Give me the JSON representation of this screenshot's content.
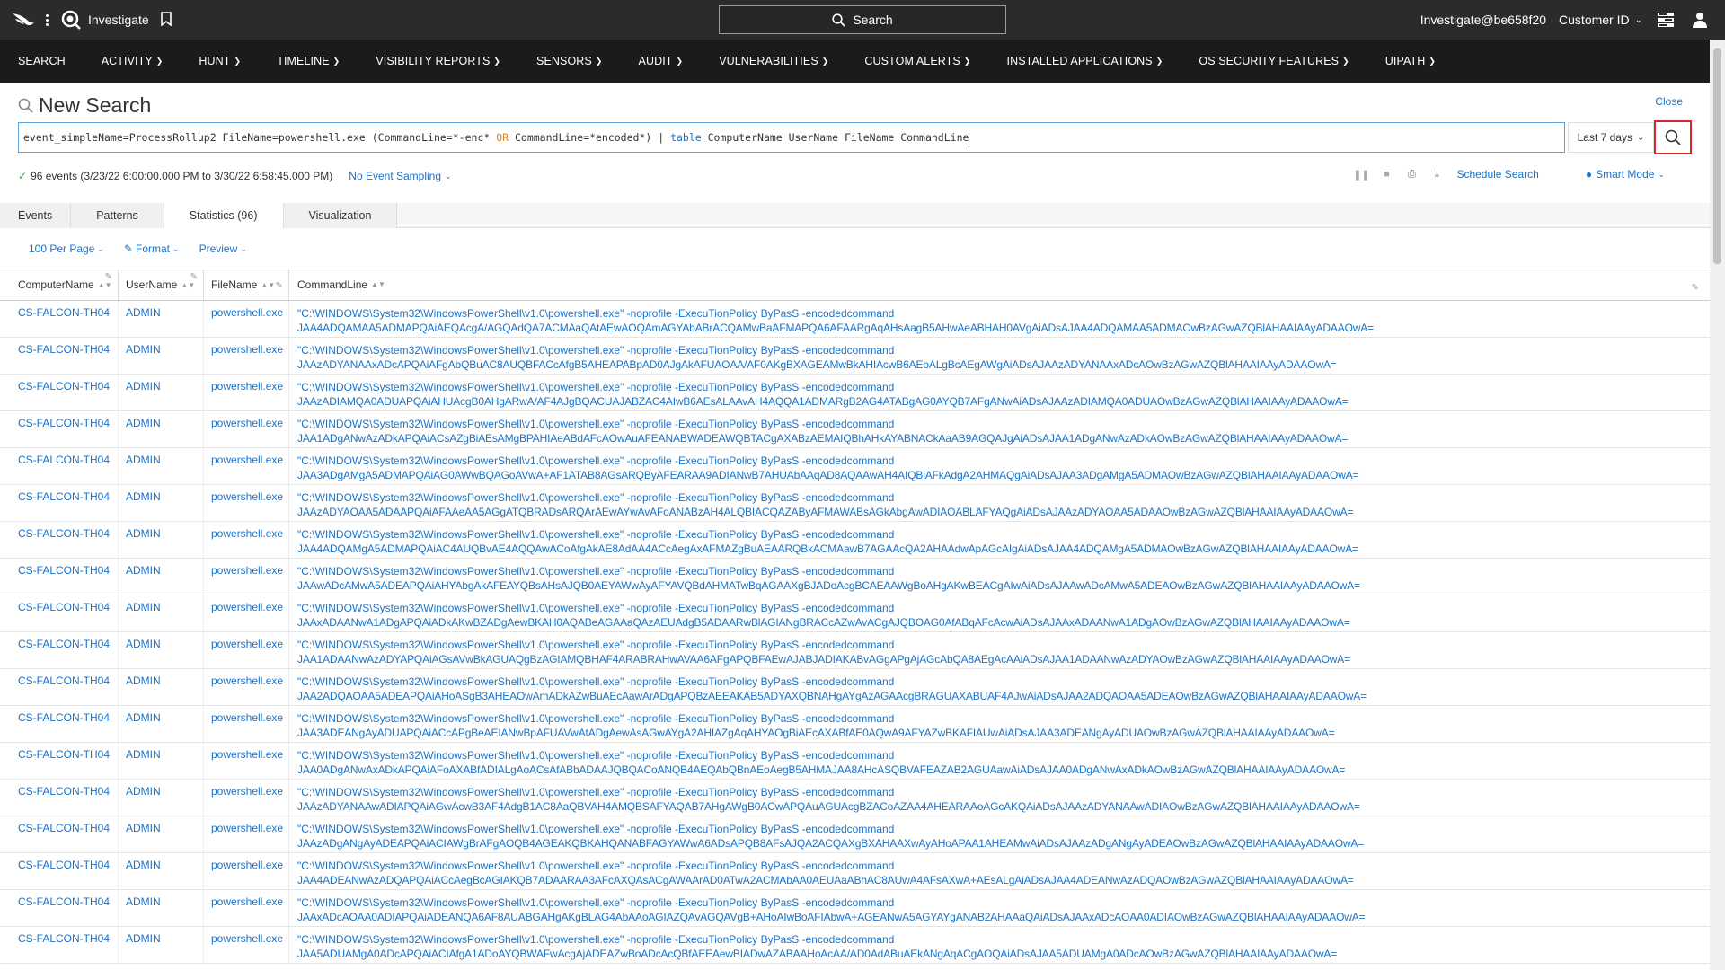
{
  "topbar": {
    "app_name": "Investigate",
    "search_label": "Search",
    "user": "Investigate@be658f20",
    "customer_label": "Customer ID"
  },
  "nav": [
    "SEARCH",
    "ACTIVITY",
    "HUNT",
    "TIMELINE",
    "VISIBILITY REPORTS",
    "SENSORS",
    "AUDIT",
    "VULNERABILITIES",
    "CUSTOM ALERTS",
    "INSTALLED APPLICATIONS",
    "OS SECURITY FEATURES",
    "UIPATH"
  ],
  "page": {
    "title": "New Search",
    "close": "Close",
    "query_parts": {
      "a": "event_simpleName=ProcessRollup2 FileName=powershell.exe (CommandLine=*-enc* ",
      "or": "OR",
      "b": " CommandLine=*encoded*) | ",
      "kw": "table",
      "c": " ComputerName UserName FileName CommandLine"
    },
    "time_range": "Last 7 days",
    "events_summary": "96 events (3/23/22 6:00:00.000 PM to 3/30/22 6:58:45.000 PM)",
    "sampling": "No Event Sampling",
    "schedule": "Schedule Search",
    "mode": "Smart Mode"
  },
  "tabs": [
    "Events",
    "Patterns",
    "Statistics (96)",
    "Visualization"
  ],
  "options": [
    "100 Per Page",
    "Format",
    "Preview"
  ],
  "columns": [
    "ComputerName",
    "UserName",
    "FileName",
    "CommandLine"
  ],
  "cmd_prefix": "\"C:\\WINDOWS\\System32\\WindowsPowerShell\\v1.0\\powershell.exe\" -noprofile -ExecuTionPolicy ByPasS -encodedcommand",
  "rows": [
    {
      "computer": "CS-FALCON-TH04",
      "user": "ADMIN",
      "file": "powershell.exe",
      "cmd2": "JAA4ADQAMAA5ADMAPQAiAEQAcgA/AGQAdQA7ACMAaQAtAEwAOQAmAGYAbABrACQAMwBaAFMAPQA6AFAARgAqAHsAagB5AHwAeABHAH0AVgAiADsAJAA4ADQAMAA5ADMAOwBzAGwAZQBlAHAAIAAyADAAOwA="
    },
    {
      "computer": "CS-FALCON-TH04",
      "user": "ADMIN",
      "file": "powershell.exe",
      "cmd2": "JAAzADYANAAxADcAPQAiAFgAbQBuAC8AUQBFACcAfgB5AHEAPABpAD0AJgAkAFUAOAA/AF0AKgBXAGEAMwBkAHIAcwB6AEoALgBcAEgAWgAiADsAJAAzADYANAAxADcAOwBzAGwAZQBlAHAAIAAyADAAOwA="
    },
    {
      "computer": "CS-FALCON-TH04",
      "user": "ADMIN",
      "file": "powershell.exe",
      "cmd2": "JAAzADIAMQA0ADUAPQAiAHUAcgB0AHgARwA/AF4AJgBQACUAJABZAC4AIwB6AEsALAAvAH4AQQA1ADMARgB2AG4ATABgAG0AYQB7AFgANwAiADsAJAAzADIAMQA0ADUAOwBzAGwAZQBlAHAAIAAyADAAOwA="
    },
    {
      "computer": "CS-FALCON-TH04",
      "user": "ADMIN",
      "file": "powershell.exe",
      "cmd2": "JAA1ADgANwAzADkAPQAiACsAZgBiAEsAMgBPAHIAeABdAFcAOwAuAFEANABWADEAWQBTACgAXABzAEMAIQBhAHkAYABNACkAaAB9AGQAJgAiADsAJAA1ADgANwAzADkAOwBzAGwAZQBlAHAAIAAyADAAOwA="
    },
    {
      "computer": "CS-FALCON-TH04",
      "user": "ADMIN",
      "file": "powershell.exe",
      "cmd2": "JAA3ADgAMgA5ADMAPQAiAG0AWwBQAGoAVwA+AF1ATAB8AGsARQByAFEARAA9ADIANwB7AHUAbAAqAD8AQAAwAH4AIQBiAFkAdgA2AHMAQgAiADsAJAA3ADgAMgA5ADMAOwBzAGwAZQBlAHAAIAAyADAAOwA="
    },
    {
      "computer": "CS-FALCON-TH04",
      "user": "ADMIN",
      "file": "powershell.exe",
      "cmd2": "JAAzADYAOAA5ADAAPQAiAFAAeAA5AGgATQBRADsARQArAEwAYwAvAFoANABzAH4ALQBIACQAZAByAFMAWABsAGkAbgAwADIAOABLAFYAQgAiADsAJAAzADYAOAA5ADAAOwBzAGwAZQBlAHAAIAAyADAAOwA="
    },
    {
      "computer": "CS-FALCON-TH04",
      "user": "ADMIN",
      "file": "powershell.exe",
      "cmd2": "JAA4ADQAMgA5ADMAPQAiAC4AUQBvAE4AQQAwACoAfgAkAE8AdAA4ACcAegAxAFMAZgBuAEAARQBkACMAawB7AGAAcQA2AHAAdwApAGcAIgAiADsAJAA4ADQAMgA5ADMAOwBzAGwAZQBlAHAAIAAyADAAOwA="
    },
    {
      "computer": "CS-FALCON-TH04",
      "user": "ADMIN",
      "file": "powershell.exe",
      "cmd2": "JAAwADcAMwA5ADEAPQAiAHYAbgAkAFEAYQBsAHsAJQB0AEYAWwAyAFYAVQBdAHMATwBqAGAAXgBJADoAcgBCAEAAWgBoAHgAKwBEACgAIwAiADsAJAAwADcAMwA5ADEAOwBzAGwAZQBlAHAAIAAyADAAOwA="
    },
    {
      "computer": "CS-FALCON-TH04",
      "user": "ADMIN",
      "file": "powershell.exe",
      "cmd2": "JAAxADAANwA1ADgAPQAiADkAKwBZADgAewBKAH0AQABeAGAAaQAzAEUAdgB5ADAARwBlAGIANgBRACcAZwAvACgAJQBOAG0AfABqAFcAcwAiADsAJAAxADAANwA1ADgAOwBzAGwAZQBlAHAAIAAyADAAOwA="
    },
    {
      "computer": "CS-FALCON-TH04",
      "user": "ADMIN",
      "file": "powershell.exe",
      "cmd2": "JAA1ADAANwAzADYAPQAiAGsAVwBkAGUAQgBzAGIAMQBHAF4ARABRAHwAVAA6AFgAPQBFAEwAJABJADIAKABvAGgAPgAjAGcAbQA8AEgAcAAiADsAJAA1ADAANwAzADYAOwBzAGwAZQBlAHAAIAAyADAAOwA="
    },
    {
      "computer": "CS-FALCON-TH04",
      "user": "ADMIN",
      "file": "powershell.exe",
      "cmd2": "JAA2ADQAOAA5ADEAPQAiAHoASgB3AHEAOwAmADkAZwBuAEcAawArADgAPQBzAEEAKAB5ADYAXQBNAHgAYgAzAGAAcgBRAGUAXABUAF4AJwAiADsAJAA2ADQAOAA5ADEAOwBzAGwAZQBlAHAAIAAyADAAOwA="
    },
    {
      "computer": "CS-FALCON-TH04",
      "user": "ADMIN",
      "file": "powershell.exe",
      "cmd2": "JAA3ADEANgAyADUAPQAiACcAPgBeAEIANwBpAFUAVwAtADgAewAsAGwAYgA2AHIAZgAqAHYAOgBiAEcAXABfAE0AQwA9AFYAZwBKAFIAUwAiADsAJAA3ADEANgAyADUAOwBzAGwAZQBlAHAAIAAyADAAOwA="
    },
    {
      "computer": "CS-FALCON-TH04",
      "user": "ADMIN",
      "file": "powershell.exe",
      "cmd2": "JAA0ADgANwAxADkAPQAiAFoAXABfADIALgAoACsAfABbADAAJQBQACoANQB4AEQAbQBnAEoAegB5AHMAJAA8AHcASQBVAFEAZAB2AGUAawAiADsAJAA0ADgANwAxADkAOwBzAGwAZQBlAHAAIAAyADAAOwA="
    },
    {
      "computer": "CS-FALCON-TH04",
      "user": "ADMIN",
      "file": "powershell.exe",
      "cmd2": "JAAzADYANAAwADIAPQAiAGwAcwB3AF4AdgB1AC8AaQBVAH4AMQBSAFYAQAB7AHgAWgB0ACwAPQAuAGUAcgBZACoAZAA4AHEARAAoAGcAKQAiADsAJAAzADYANAAwADIAOwBzAGwAZQBlAHAAIAAyADAAOwA="
    },
    {
      "computer": "CS-FALCON-TH04",
      "user": "ADMIN",
      "file": "powershell.exe",
      "cmd2": "JAAzADgANgAyADEAPQAiACIAWgBrAFgAOQB4AGEAKQBKAHQANABFAGYAWwA6ADsAPQB8AFsAJQA2ACQAXgBXAHAAXwAyAHoAPAA1AHEAMwAiADsAJAAzADgANgAyADEAOwBzAGwAZQBlAHAAIAAyADAAOwA="
    },
    {
      "computer": "CS-FALCON-TH04",
      "user": "ADMIN",
      "file": "powershell.exe",
      "cmd2": "JAA4ADEANwAzADQAPQAiACcAegBcAGIAKQB7ADAARAA3AFcAXQAsACgAWAArAD0ATwA2ACMAbAA0AEUAaABhAC8AUwA4AFsAXwA+AEsALgAiADsAJAA4ADEANwAzADQAOwBzAGwAZQBlAHAAIAAyADAAOwA="
    },
    {
      "computer": "CS-FALCON-TH04",
      "user": "ADMIN",
      "file": "powershell.exe",
      "cmd2": "JAAxADcAOAA0ADIAPQAiADEANQA6AF8AUABGAHgAKgBLAG4AbAAoAGIAZQAvAGQAVgB+AHoAIwBoAFIAbwA+AGEANwA5AGYAYgANAB2AHAAaQAiADsAJAAxADcAOAA0ADIAOwBzAGwAZQBlAHAAIAAyADAAOwA="
    },
    {
      "computer": "CS-FALCON-TH04",
      "user": "ADMIN",
      "file": "powershell.exe",
      "cmd2": "JAA5ADUAMgA0ADcAPQAiACIAfgA1ADoAYQBWAFwAcgAjADEAZwBoADcAcQBfAEEAewBIADwAZABAAHoAcAA/AD0AdABuAEkANgAqACgAOQAiADsAJAA5ADUAMgA0ADcAOwBzAGwAZQBlAHAAIAAyADAAOwA="
    }
  ],
  "colors": {
    "link": "#1a73c8",
    "topbar": "#2b2b2b",
    "navbar": "#1b1b1b",
    "highlight": "#d9262c"
  },
  "icons": [
    "falcon-logo-icon",
    "investigate-icon",
    "bookmark-icon",
    "search-icon",
    "chevron-down-icon",
    "tray-icon",
    "user-icon",
    "magnify-icon",
    "pause-icon",
    "stop-icon",
    "print-icon",
    "download-icon",
    "pin-icon",
    "edit-icon",
    "sort-icon"
  ]
}
